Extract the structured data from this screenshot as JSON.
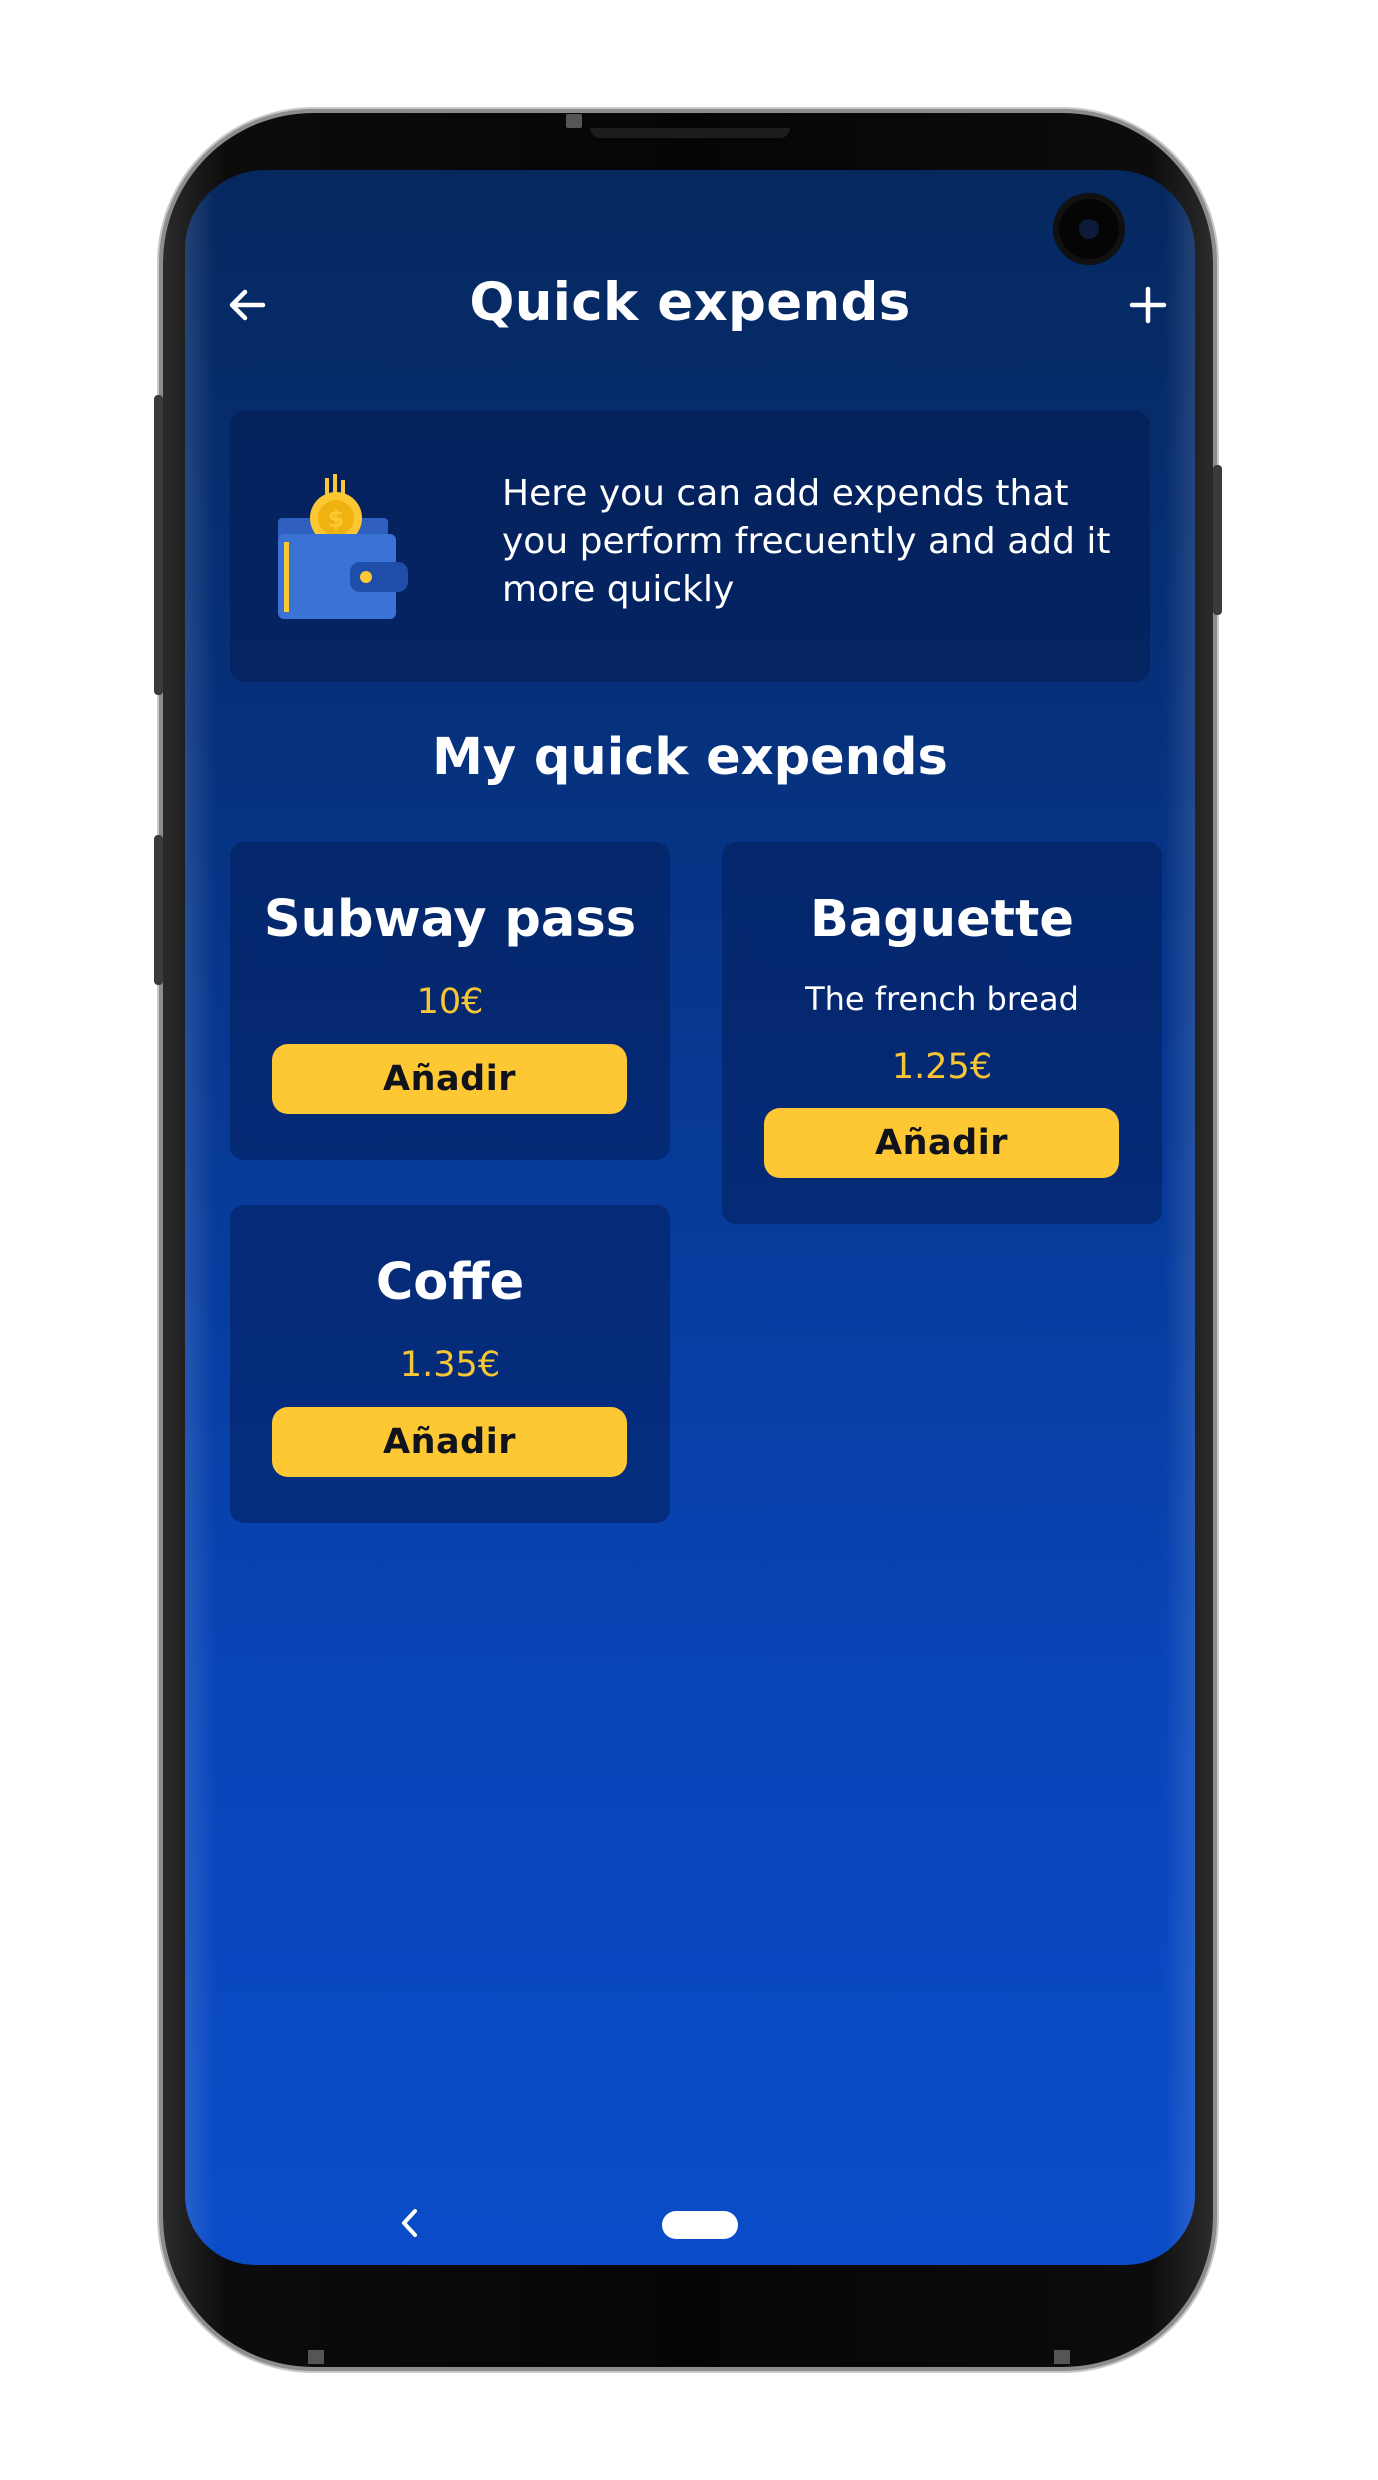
{
  "header": {
    "title": "Quick expends",
    "back_icon": "arrow-left-icon",
    "add_icon": "plus-icon"
  },
  "info": {
    "icon": "wallet-coin-icon",
    "text": "Here you can add expends that you perform frecuently and add it more quickly"
  },
  "section_title": "My quick expends",
  "expenses": [
    {
      "name": "Subway pass",
      "description": "",
      "price": "10€",
      "button_label": "Añadir"
    },
    {
      "name": "Baguette",
      "description": "The french bread",
      "price": "1.25€",
      "button_label": "Añadir"
    },
    {
      "name": "Coffe",
      "description": "",
      "price": "1.35€",
      "button_label": "Añadir"
    }
  ],
  "colors": {
    "accent": "#fdc834",
    "price": "#f7c634",
    "background_top": "#05285e",
    "background_bottom": "#0a4cc8"
  }
}
